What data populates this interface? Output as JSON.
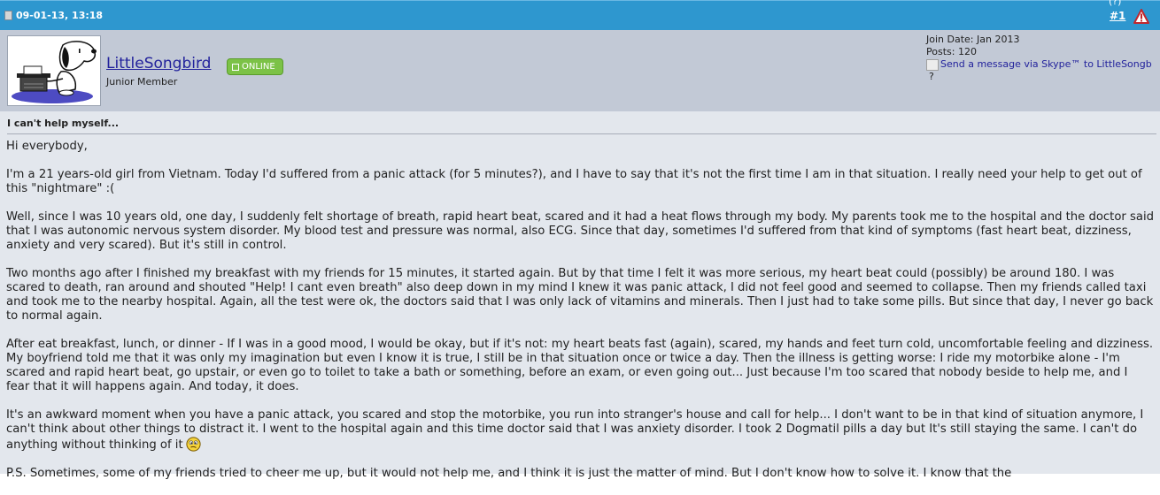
{
  "post": {
    "date": "09-01-13, 13:18",
    "number": "#1",
    "top_sliver": "(?)"
  },
  "user": {
    "name": "LittleSongbird",
    "status": "ONLINE",
    "title": "Junior Member",
    "join_date": "Join Date: Jan 2013",
    "posts": "Posts: 120",
    "skype": "Send a message via Skype™ to LittleSongb",
    "question": "?"
  },
  "message": {
    "title": "I can't help myself...",
    "paragraphs": [
      "Hi everybody,",
      "I'm a 21 years-old girl from Vietnam. Today I'd suffered from a panic attack (for 5 minutes?), and I have to say that it's not the first time I am in that situation. I really need your help to get out of this \"nightmare\" :(",
      "Well, since I was 10 years old, one day, I suddenly felt shortage of breath, rapid heart beat, scared and it had a heat flows through my body. My parents took me to the hospital and the doctor said that I was autonomic nervous system disorder. My blood test and pressure was normal, also ECG. Since that day, sometimes I'd suffered from that kind of symptoms (fast heart beat, dizziness, anxiety and very scared). But it's still in control.",
      "Two months ago after I finished my breakfast with my friends for 15 minutes, it started again. But by that time I felt it was more serious, my heart beat could (possibly) be around 180. I was scared to death, ran around and shouted \"Help! I cant even breath\" also deep down in my mind I knew it was panic attack, I did not feel good and seemed to collapse. Then my friends called taxi and took me to the nearby hospital. Again, all the test were ok, the doctors said that I was only lack of vitamins and minerals. Then I just had to take some pills. But since that day, I never go back to normal again.",
      "After eat breakfast, lunch, or dinner - If I was in a good mood, I would be okay, but if it's not: my heart beats fast (again), scared, my hands and feet turn cold, uncomfortable feeling and dizziness. My boyfriend told me that it was only my imagination but even I know it is true, I still be in that situation once or twice a day. Then the illness is getting worse: I ride my motorbike alone - I'm scared and rapid heart beat, go upstair, or even go to toilet to take a bath or something, before an exam, or even going out... Just because I'm too scared that nobody beside to help me, and I fear that it will happens again. And today, it does.",
      "It's an awkward moment when you have a panic attack, you scared and stop the motorbike, you run into stranger's house and call for help... I don't want to be in that kind of situation anymore, I can't think about other things to distract it. I went to the hospital again and this time doctor said that I was anxiety disorder. I took 2 Dogmatil pills a day but It's still staying the same. I can't do anything without thinking of it",
      "P.S. Sometimes, some of my friends tried to cheer me up, but it would not help me, and I think it is just the matter of mind. But I don't know how to solve it. I know that the"
    ]
  },
  "icons": {
    "header": "document-icon",
    "report": "warning-triangle-icon",
    "avatar": "snoopy-typewriter-avatar",
    "smiley": "confused-smiley-icon"
  },
  "colors": {
    "header_bg": "#2e97cf",
    "userinfo_bg": "#c2c9d6",
    "body_bg": "#e3e7ed",
    "online_green": "#7cc247",
    "link_blue": "#22229c"
  }
}
